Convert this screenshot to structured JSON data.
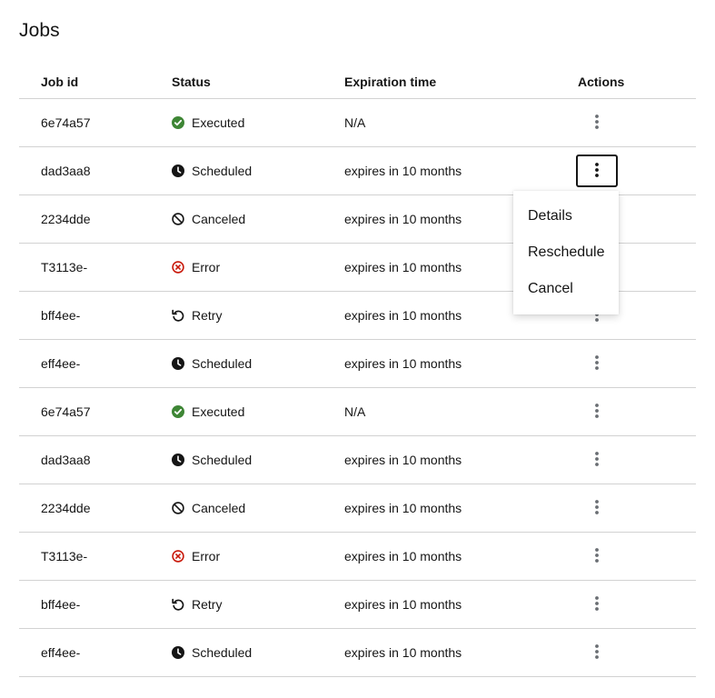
{
  "page": {
    "title": "Jobs"
  },
  "table": {
    "columns": {
      "job_id": "Job id",
      "status": "Status",
      "expiration": "Expiration time",
      "actions": "Actions"
    },
    "rows": [
      {
        "job_id": "6e74a57",
        "status": "Executed",
        "status_icon": "check-circle-icon",
        "expiration": "N/A"
      },
      {
        "job_id": "dad3aa8",
        "status": "Scheduled",
        "status_icon": "clock-icon",
        "expiration": "expires in 10 months"
      },
      {
        "job_id": "2234dde",
        "status": "Canceled",
        "status_icon": "ban-icon",
        "expiration": "expires in 10 months"
      },
      {
        "job_id": "T3113e-",
        "status": "Error",
        "status_icon": "error-circle-icon",
        "expiration": "expires in 10 months"
      },
      {
        "job_id": "bff4ee-",
        "status": "Retry",
        "status_icon": "retry-icon",
        "expiration": "expires in 10 months"
      },
      {
        "job_id": "eff4ee-",
        "status": "Scheduled",
        "status_icon": "clock-icon",
        "expiration": "expires in 10 months"
      },
      {
        "job_id": "6e74a57",
        "status": "Executed",
        "status_icon": "check-circle-icon",
        "expiration": "N/A"
      },
      {
        "job_id": "dad3aa8",
        "status": "Scheduled",
        "status_icon": "clock-icon",
        "expiration": "expires in 10 months"
      },
      {
        "job_id": "2234dde",
        "status": "Canceled",
        "status_icon": "ban-icon",
        "expiration": "expires in 10 months"
      },
      {
        "job_id": "T3113e-",
        "status": "Error",
        "status_icon": "error-circle-icon",
        "expiration": "expires in 10 months"
      },
      {
        "job_id": "bff4ee-",
        "status": "Retry",
        "status_icon": "retry-icon",
        "expiration": "expires in 10 months"
      },
      {
        "job_id": "eff4ee-",
        "status": "Scheduled",
        "status_icon": "clock-icon",
        "expiration": "expires in 10 months"
      }
    ]
  },
  "actions_menu": {
    "open_row": 1,
    "items": [
      "Details",
      "Reschedule",
      "Cancel"
    ]
  },
  "colors": {
    "success": "#3e8635",
    "danger": "#c9190b",
    "text": "#151515",
    "border": "#d2d2d2",
    "icon": "#6a6e73"
  }
}
